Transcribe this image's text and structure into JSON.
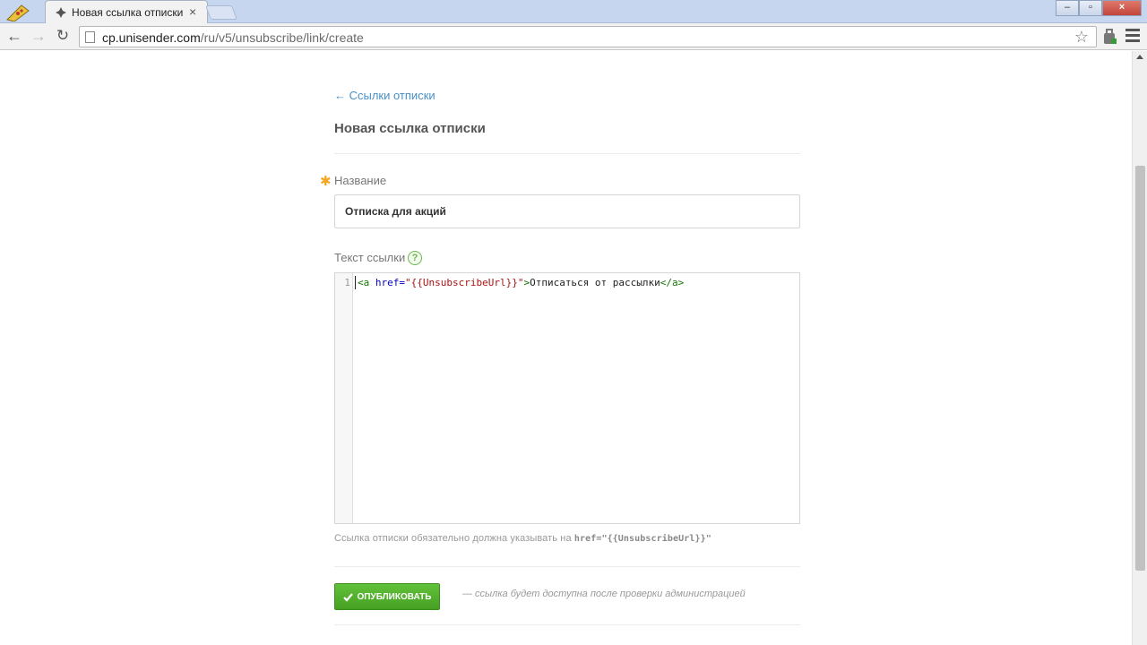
{
  "browser": {
    "tab_title": "Новая ссылка отписки",
    "tab_close": "×",
    "url_domain": "cp.unisender.com",
    "url_path": "/ru/v5/unsubscribe/link/create",
    "window_controls": {
      "minimize": "–",
      "maximize": "▫",
      "close": "×"
    }
  },
  "page": {
    "back_link": "← Ссылки отписки",
    "title": "Новая ссылка отписки",
    "name_field": {
      "required_mark": "✱",
      "label": "Название",
      "value": "Отписка для акций"
    },
    "link_text_field": {
      "label": "Текст ссылки",
      "help": "?",
      "line_number": "1",
      "code": {
        "open_tag": "<a",
        "attr": " href=",
        "value": "\"{{UnsubscribeUrl}}\"",
        "close_open": ">",
        "text": "Отписаться от рассылки",
        "close_tag": "</a>"
      }
    },
    "hint": {
      "text": "Ссылка отписки обязательно должна указывать на",
      "code": "href=\"{{UnsubscribeUrl}}\""
    },
    "publish_button": "ОПУБЛИКОВАТЬ",
    "publish_note": "— ссылка будет доступна после проверки администрацией"
  },
  "colors": {
    "accent_link": "#4a90c8",
    "publish_green": "#4fa829",
    "required_orange": "#f5a623"
  }
}
